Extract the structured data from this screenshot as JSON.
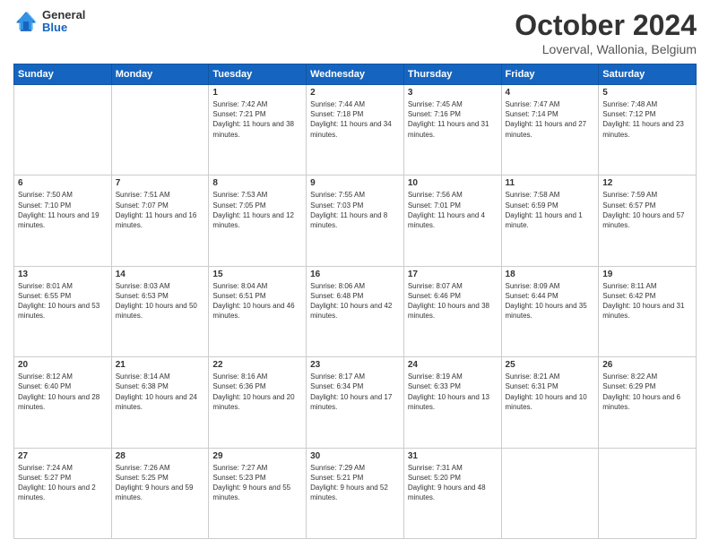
{
  "header": {
    "logo": {
      "general": "General",
      "blue": "Blue"
    },
    "month": "October 2024",
    "location": "Loverval, Wallonia, Belgium"
  },
  "weekdays": [
    "Sunday",
    "Monday",
    "Tuesday",
    "Wednesday",
    "Thursday",
    "Friday",
    "Saturday"
  ],
  "weeks": [
    [
      {
        "day": "",
        "sunrise": "",
        "sunset": "",
        "daylight": ""
      },
      {
        "day": "",
        "sunrise": "",
        "sunset": "",
        "daylight": ""
      },
      {
        "day": "1",
        "sunrise": "Sunrise: 7:42 AM",
        "sunset": "Sunset: 7:21 PM",
        "daylight": "Daylight: 11 hours and 38 minutes."
      },
      {
        "day": "2",
        "sunrise": "Sunrise: 7:44 AM",
        "sunset": "Sunset: 7:18 PM",
        "daylight": "Daylight: 11 hours and 34 minutes."
      },
      {
        "day": "3",
        "sunrise": "Sunrise: 7:45 AM",
        "sunset": "Sunset: 7:16 PM",
        "daylight": "Daylight: 11 hours and 31 minutes."
      },
      {
        "day": "4",
        "sunrise": "Sunrise: 7:47 AM",
        "sunset": "Sunset: 7:14 PM",
        "daylight": "Daylight: 11 hours and 27 minutes."
      },
      {
        "day": "5",
        "sunrise": "Sunrise: 7:48 AM",
        "sunset": "Sunset: 7:12 PM",
        "daylight": "Daylight: 11 hours and 23 minutes."
      }
    ],
    [
      {
        "day": "6",
        "sunrise": "Sunrise: 7:50 AM",
        "sunset": "Sunset: 7:10 PM",
        "daylight": "Daylight: 11 hours and 19 minutes."
      },
      {
        "day": "7",
        "sunrise": "Sunrise: 7:51 AM",
        "sunset": "Sunset: 7:07 PM",
        "daylight": "Daylight: 11 hours and 16 minutes."
      },
      {
        "day": "8",
        "sunrise": "Sunrise: 7:53 AM",
        "sunset": "Sunset: 7:05 PM",
        "daylight": "Daylight: 11 hours and 12 minutes."
      },
      {
        "day": "9",
        "sunrise": "Sunrise: 7:55 AM",
        "sunset": "Sunset: 7:03 PM",
        "daylight": "Daylight: 11 hours and 8 minutes."
      },
      {
        "day": "10",
        "sunrise": "Sunrise: 7:56 AM",
        "sunset": "Sunset: 7:01 PM",
        "daylight": "Daylight: 11 hours and 4 minutes."
      },
      {
        "day": "11",
        "sunrise": "Sunrise: 7:58 AM",
        "sunset": "Sunset: 6:59 PM",
        "daylight": "Daylight: 11 hours and 1 minute."
      },
      {
        "day": "12",
        "sunrise": "Sunrise: 7:59 AM",
        "sunset": "Sunset: 6:57 PM",
        "daylight": "Daylight: 10 hours and 57 minutes."
      }
    ],
    [
      {
        "day": "13",
        "sunrise": "Sunrise: 8:01 AM",
        "sunset": "Sunset: 6:55 PM",
        "daylight": "Daylight: 10 hours and 53 minutes."
      },
      {
        "day": "14",
        "sunrise": "Sunrise: 8:03 AM",
        "sunset": "Sunset: 6:53 PM",
        "daylight": "Daylight: 10 hours and 50 minutes."
      },
      {
        "day": "15",
        "sunrise": "Sunrise: 8:04 AM",
        "sunset": "Sunset: 6:51 PM",
        "daylight": "Daylight: 10 hours and 46 minutes."
      },
      {
        "day": "16",
        "sunrise": "Sunrise: 8:06 AM",
        "sunset": "Sunset: 6:48 PM",
        "daylight": "Daylight: 10 hours and 42 minutes."
      },
      {
        "day": "17",
        "sunrise": "Sunrise: 8:07 AM",
        "sunset": "Sunset: 6:46 PM",
        "daylight": "Daylight: 10 hours and 38 minutes."
      },
      {
        "day": "18",
        "sunrise": "Sunrise: 8:09 AM",
        "sunset": "Sunset: 6:44 PM",
        "daylight": "Daylight: 10 hours and 35 minutes."
      },
      {
        "day": "19",
        "sunrise": "Sunrise: 8:11 AM",
        "sunset": "Sunset: 6:42 PM",
        "daylight": "Daylight: 10 hours and 31 minutes."
      }
    ],
    [
      {
        "day": "20",
        "sunrise": "Sunrise: 8:12 AM",
        "sunset": "Sunset: 6:40 PM",
        "daylight": "Daylight: 10 hours and 28 minutes."
      },
      {
        "day": "21",
        "sunrise": "Sunrise: 8:14 AM",
        "sunset": "Sunset: 6:38 PM",
        "daylight": "Daylight: 10 hours and 24 minutes."
      },
      {
        "day": "22",
        "sunrise": "Sunrise: 8:16 AM",
        "sunset": "Sunset: 6:36 PM",
        "daylight": "Daylight: 10 hours and 20 minutes."
      },
      {
        "day": "23",
        "sunrise": "Sunrise: 8:17 AM",
        "sunset": "Sunset: 6:34 PM",
        "daylight": "Daylight: 10 hours and 17 minutes."
      },
      {
        "day": "24",
        "sunrise": "Sunrise: 8:19 AM",
        "sunset": "Sunset: 6:33 PM",
        "daylight": "Daylight: 10 hours and 13 minutes."
      },
      {
        "day": "25",
        "sunrise": "Sunrise: 8:21 AM",
        "sunset": "Sunset: 6:31 PM",
        "daylight": "Daylight: 10 hours and 10 minutes."
      },
      {
        "day": "26",
        "sunrise": "Sunrise: 8:22 AM",
        "sunset": "Sunset: 6:29 PM",
        "daylight": "Daylight: 10 hours and 6 minutes."
      }
    ],
    [
      {
        "day": "27",
        "sunrise": "Sunrise: 7:24 AM",
        "sunset": "Sunset: 5:27 PM",
        "daylight": "Daylight: 10 hours and 2 minutes."
      },
      {
        "day": "28",
        "sunrise": "Sunrise: 7:26 AM",
        "sunset": "Sunset: 5:25 PM",
        "daylight": "Daylight: 9 hours and 59 minutes."
      },
      {
        "day": "29",
        "sunrise": "Sunrise: 7:27 AM",
        "sunset": "Sunset: 5:23 PM",
        "daylight": "Daylight: 9 hours and 55 minutes."
      },
      {
        "day": "30",
        "sunrise": "Sunrise: 7:29 AM",
        "sunset": "Sunset: 5:21 PM",
        "daylight": "Daylight: 9 hours and 52 minutes."
      },
      {
        "day": "31",
        "sunrise": "Sunrise: 7:31 AM",
        "sunset": "Sunset: 5:20 PM",
        "daylight": "Daylight: 9 hours and 48 minutes."
      },
      {
        "day": "",
        "sunrise": "",
        "sunset": "",
        "daylight": ""
      },
      {
        "day": "",
        "sunrise": "",
        "sunset": "",
        "daylight": ""
      }
    ]
  ]
}
